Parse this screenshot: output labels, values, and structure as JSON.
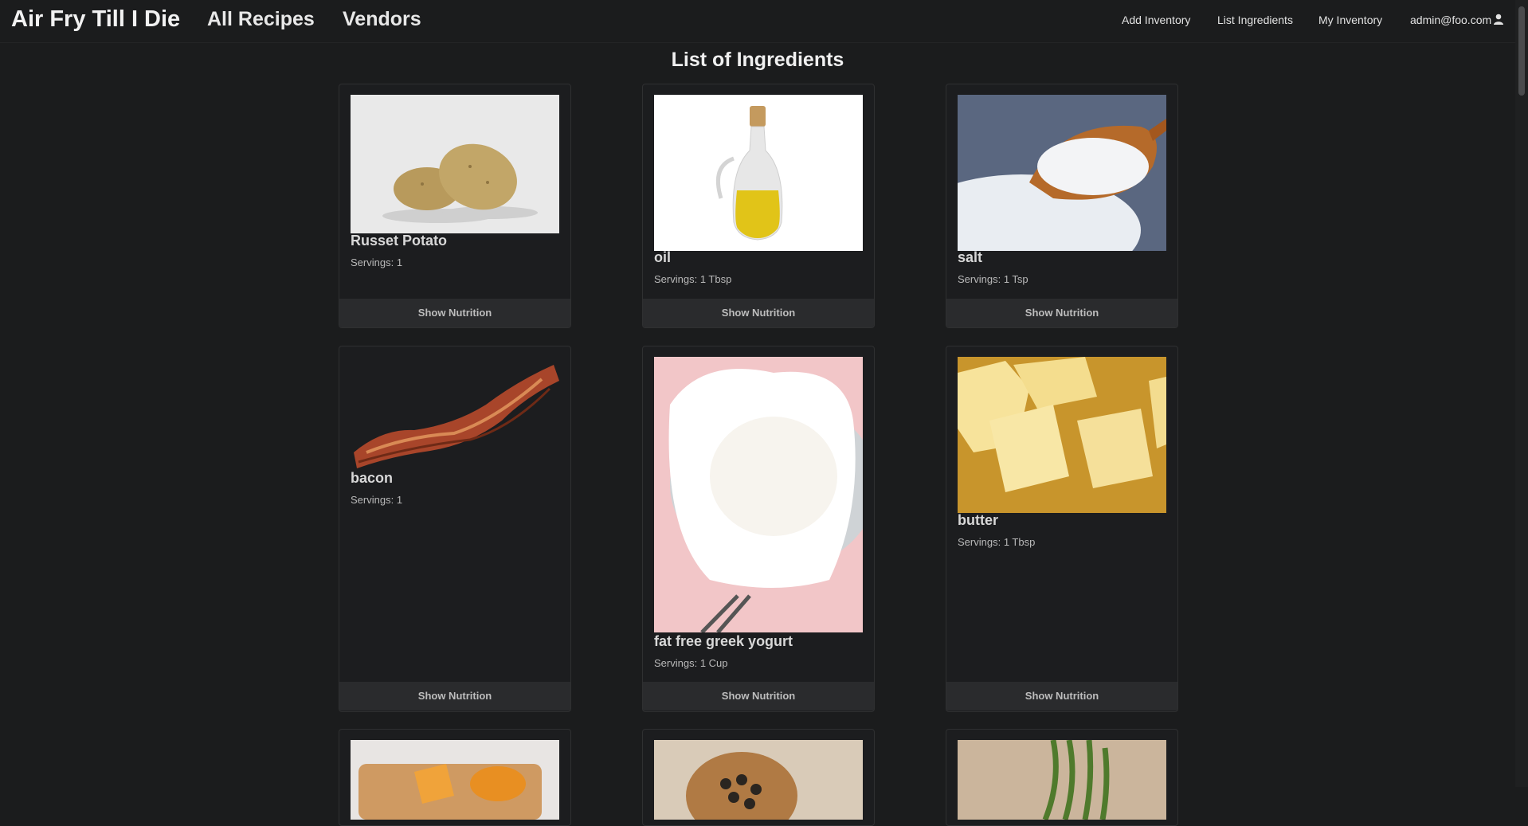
{
  "brand": "Air Fry Till I Die",
  "nav": {
    "all_recipes": "All Recipes",
    "vendors": "Vendors",
    "add_inventory": "Add Inventory",
    "list_ingredients": "List Ingredients",
    "my_inventory": "My Inventory",
    "user_email": "admin@foo.com"
  },
  "page_title": "List of Ingredients",
  "servings_label": "Servings: ",
  "button_label": "Show Nutrition",
  "cards": [
    {
      "name": "Russet Potato",
      "servings": "1"
    },
    {
      "name": "oil",
      "servings": "1 Tbsp"
    },
    {
      "name": "salt",
      "servings": "1 Tsp"
    },
    {
      "name": "bacon",
      "servings": "1"
    },
    {
      "name": "fat free greek yogurt",
      "servings": "1 Cup"
    },
    {
      "name": "butter",
      "servings": "1 Tbsp"
    }
  ],
  "icons": [
    "user-icon"
  ],
  "colors": {
    "background": "#1b1c1d",
    "card_border": "#2f3031",
    "button_bg": "#2a2b2d"
  }
}
